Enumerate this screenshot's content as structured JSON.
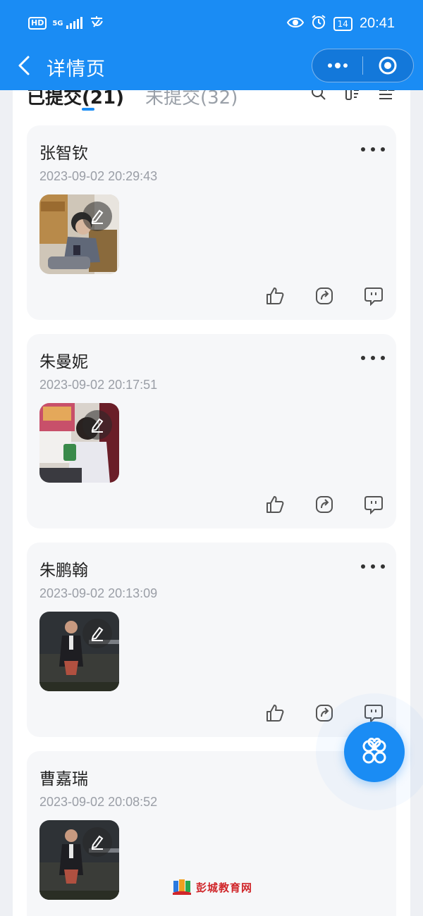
{
  "status_bar": {
    "hd": "HD",
    "network": "5G",
    "time": "20:41",
    "battery": "14",
    "battery_level": 0.14,
    "icons": [
      "hd-icon",
      "signal-icon",
      "wechat-text-icon",
      "eye-icon",
      "alarm-icon",
      "battery-icon"
    ]
  },
  "nav": {
    "title": "详情页",
    "back_icon": "chevron-left-icon",
    "more_icon": "more-dots-icon",
    "close_icon": "target-circle-icon"
  },
  "tabs": {
    "submitted": "已提交(21)",
    "not_submitted": "未提交(32)",
    "icons": [
      "search-icon",
      "filter-icon",
      "sort-icon"
    ]
  },
  "records": [
    {
      "name": "张智钦",
      "time": "2023-09-02 20:29:43",
      "thumb": "photo-child-with-phone"
    },
    {
      "name": "朱曼妮",
      "time": "2023-09-02 20:17:51",
      "thumb": "photo-child-with-phone"
    },
    {
      "name": "朱鹏翰",
      "time": "2023-09-02 20:13:09",
      "thumb": "video-still-presenter"
    },
    {
      "name": "曹嘉瑞",
      "time": "2023-09-02 20:08:52",
      "thumb": "video-still-presenter"
    }
  ],
  "actions": {
    "icons": [
      "thumbs-up-icon",
      "share-icon",
      "comment-icon"
    ],
    "edit_icon": "edit-pen-icon"
  },
  "fab": {
    "icon": "four-petal-menu-icon"
  },
  "watermark": {
    "text": "彭城教育网"
  },
  "colors": {
    "primary": "#1a8cf4",
    "card_bg": "#f6f7f9",
    "page_bg": "#eef0f4",
    "muted_text": "#9a9ea6",
    "watermark": "#d0262a"
  }
}
